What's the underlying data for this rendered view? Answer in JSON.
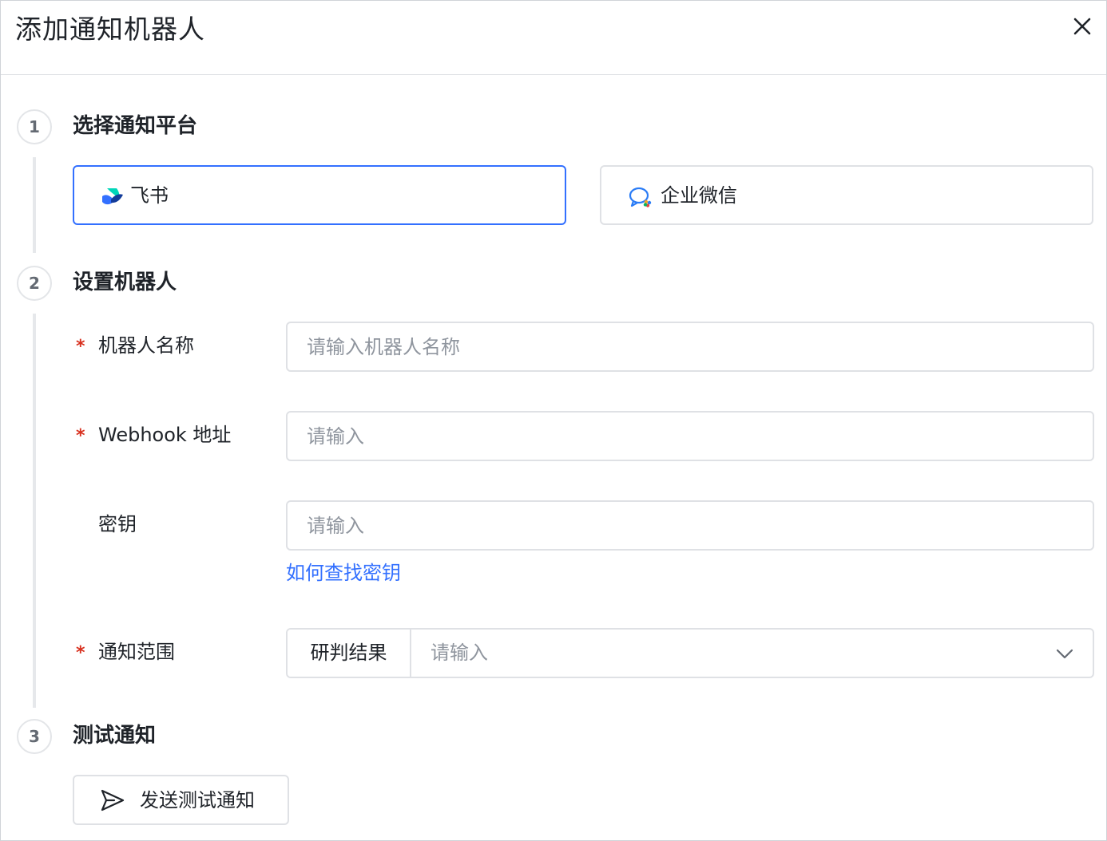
{
  "dialog": {
    "title": "添加通知机器人",
    "close_icon": "close-icon"
  },
  "steps": [
    {
      "number": "1",
      "title": "选择通知平台"
    },
    {
      "number": "2",
      "title": "设置机器人"
    },
    {
      "number": "3",
      "title": "测试通知"
    }
  ],
  "platforms": [
    {
      "label": "飞书",
      "icon": "feishu-icon",
      "selected": true
    },
    {
      "label": "企业微信",
      "icon": "wecom-icon",
      "selected": false
    }
  ],
  "form": {
    "robot_name": {
      "required_mark": "*",
      "label": "机器人名称",
      "placeholder": "请输入机器人名称",
      "value": ""
    },
    "webhook": {
      "required_mark": "*",
      "label": "Webhook 地址",
      "placeholder": "请输入",
      "value": ""
    },
    "secret": {
      "label": "密钥",
      "placeholder": "请输入",
      "value": "",
      "help_link": "如何查找密钥"
    },
    "scope": {
      "required_mark": "*",
      "label": "通知范围",
      "addon": "研判结果",
      "placeholder": "请输入"
    }
  },
  "test": {
    "button_label": "发送测试通知",
    "icon": "send-icon"
  },
  "colors": {
    "accent": "#3370ff",
    "required": "#d8311f",
    "border": "#dfe1e5",
    "placeholder": "#8f959e"
  }
}
